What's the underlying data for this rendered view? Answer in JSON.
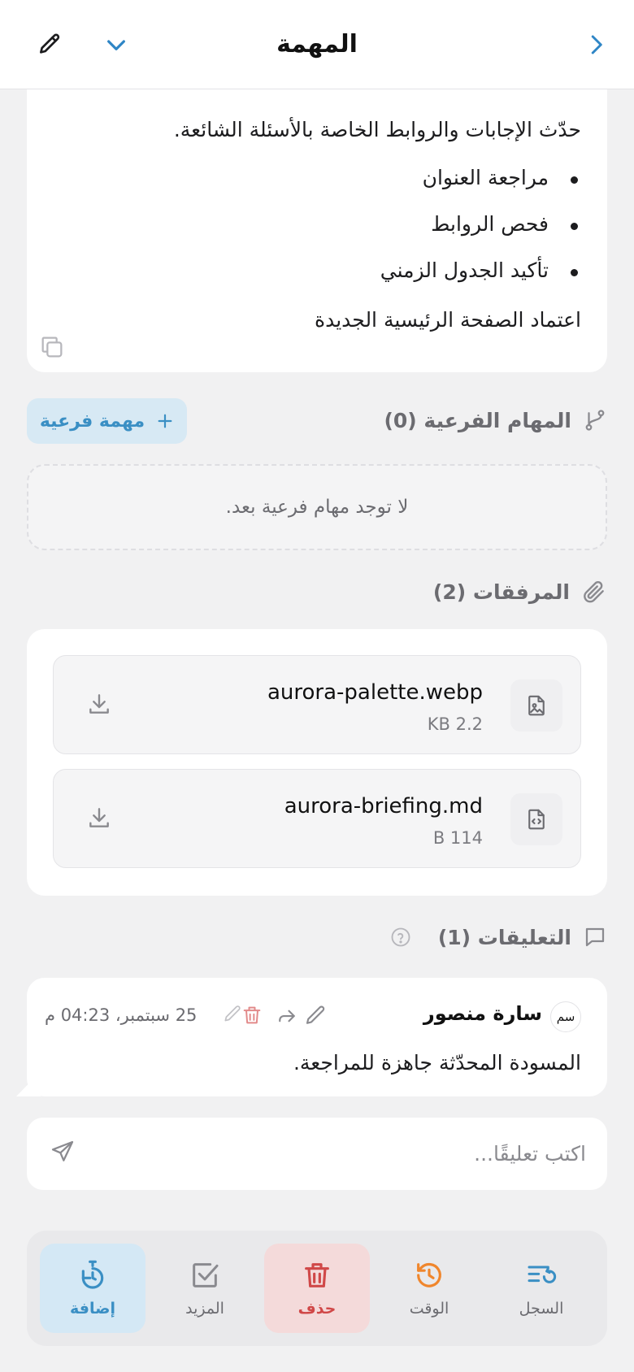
{
  "header": {
    "title": "المهمة"
  },
  "description": {
    "intro": "حدّث الإجابات والروابط الخاصة بالأسئلة الشائعة.",
    "bullets": [
      "مراجعة العنوان",
      "فحص الروابط",
      "تأكيد الجدول الزمني"
    ],
    "closing": "اعتماد الصفحة الرئيسية الجديدة"
  },
  "subtasks": {
    "title": "المهام الفرعية (0)",
    "add_label": "مهمة فرعية",
    "empty_text": "لا توجد مهام فرعية بعد."
  },
  "attachments": {
    "title": "المرفقات (2)",
    "items": [
      {
        "name": "aurora-palette.webp",
        "size": "KB 2.2",
        "icon": "image-file-icon"
      },
      {
        "name": "aurora-briefing.md",
        "size": "B 114",
        "icon": "code-file-icon"
      }
    ]
  },
  "comments": {
    "title": "التعليقات (1)",
    "items": [
      {
        "avatar": "سم",
        "author": "سارة منصور",
        "date": "25 سبتمبر، 04:23 م",
        "text": "المسودة المحدّثة جاهزة للمراجعة."
      }
    ],
    "input_placeholder": "اكتب تعليقًا..."
  },
  "bottom_bar": {
    "tabs": [
      {
        "label": "السجل",
        "icon": "history-list-icon"
      },
      {
        "label": "الوقت",
        "icon": "clock-history-icon"
      },
      {
        "label": "حذف",
        "icon": "trash-icon"
      },
      {
        "label": "المزيد",
        "icon": "checkbox-icon"
      },
      {
        "label": "إضافة",
        "icon": "timer-add-icon"
      }
    ]
  },
  "colors": {
    "accent": "#3a8fc4",
    "danger": "#d04848",
    "warning": "#f0862c",
    "background": "#f1f1f2"
  }
}
